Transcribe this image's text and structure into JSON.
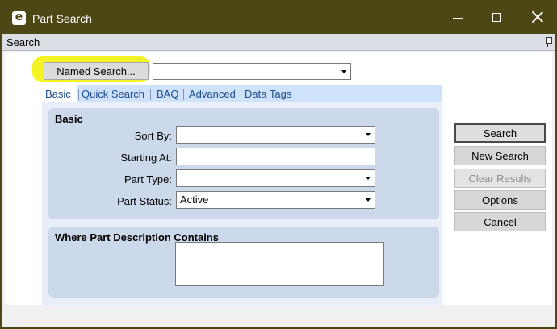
{
  "window": {
    "title": "Part Search",
    "app_icon_letter": "e"
  },
  "panel": {
    "label": "Search"
  },
  "named_search": {
    "button_label": "Named Search...",
    "value": ""
  },
  "tabs": [
    {
      "label": "Basic",
      "active": true
    },
    {
      "label": "Quick Search",
      "active": false
    },
    {
      "label": "BAQ",
      "active": false
    },
    {
      "label": "Advanced",
      "active": false
    },
    {
      "label": "Data Tags",
      "active": false
    }
  ],
  "basic_group": {
    "title": "Basic",
    "fields": [
      {
        "label": "Sort By:",
        "value": "",
        "type": "select"
      },
      {
        "label": "Starting At:",
        "value": "",
        "type": "text"
      },
      {
        "label": "Part Type:",
        "value": "",
        "type": "select"
      },
      {
        "label": "Part Status:",
        "value": "Active",
        "type": "select"
      }
    ]
  },
  "description_group": {
    "title": "Where Part Description Contains",
    "value": ""
  },
  "actions": {
    "search": "Search",
    "new_search": "New Search",
    "clear_results": "Clear Results",
    "options": "Options",
    "cancel": "Cancel"
  },
  "colors": {
    "titlebar": "#4c4714",
    "highlight": "#f3f326",
    "tabbar": "#cfe2fb",
    "group": "#ccd9ea"
  }
}
